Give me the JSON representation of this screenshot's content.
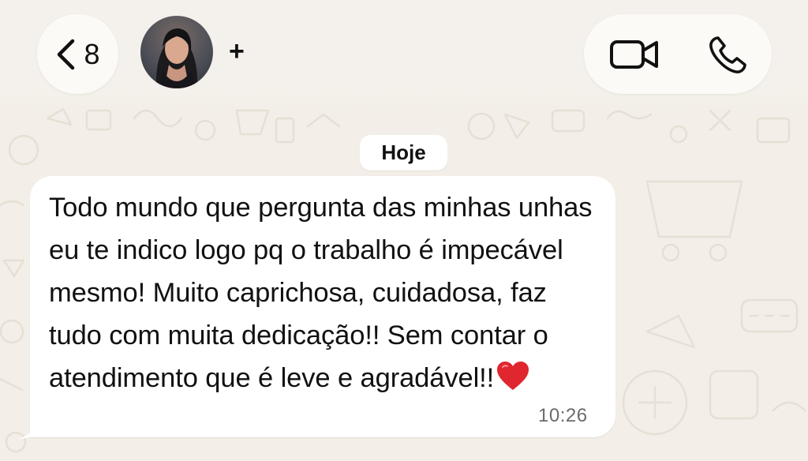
{
  "header": {
    "back_count": "8",
    "add_label": "+"
  },
  "icons": {
    "back": "chevron-left-icon",
    "video": "video-camera-icon",
    "phone": "phone-icon",
    "heart": "red-heart-emoji"
  },
  "colors": {
    "background": "#f3efe8",
    "bubble": "#ffffff",
    "heart": "#e0262f",
    "timestamp": "#6b6b6b"
  },
  "chat": {
    "date_label": "Hoje",
    "message": {
      "text": "Todo mundo que pergunta das minhas unhas eu te indico logo pq o trabalho é impecável mesmo! Muito caprichosa, cuidadosa, faz tudo com muita dedicação!! Sem contar o atendimento que é leve e agradável!!",
      "time": "10:26"
    }
  }
}
